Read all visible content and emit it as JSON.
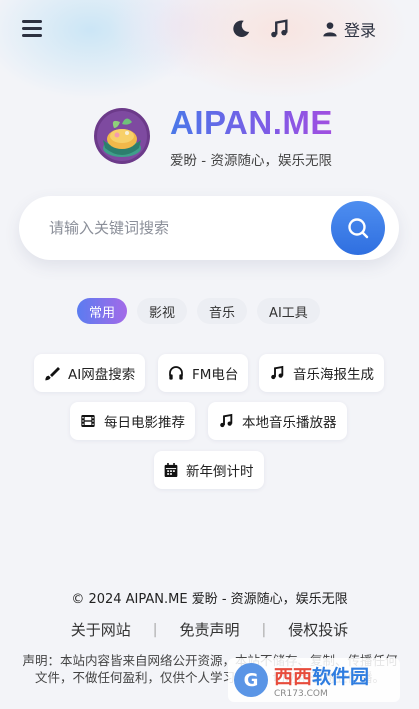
{
  "header": {
    "login_label": "登录"
  },
  "brand": {
    "title": "AIPAN.ME",
    "subtitle": "爱盼 - 资源随心，娱乐无限"
  },
  "search": {
    "placeholder": "请输入关键词搜索",
    "value": ""
  },
  "tabs": [
    {
      "label": "常用",
      "active": true
    },
    {
      "label": "影视",
      "active": false
    },
    {
      "label": "音乐",
      "active": false
    },
    {
      "label": "AI工具",
      "active": false
    }
  ],
  "tools": [
    {
      "label": "AI网盘搜索",
      "icon": "brush-icon"
    },
    {
      "label": "FM电台",
      "icon": "headphones-icon"
    },
    {
      "label": "音乐海报生成",
      "icon": "music-icon"
    },
    {
      "label": "每日电影推荐",
      "icon": "film-icon"
    },
    {
      "label": "本地音乐播放器",
      "icon": "music-icon"
    },
    {
      "label": "新年倒计时",
      "icon": "calendar-icon"
    }
  ],
  "footer": {
    "copyright": "© 2024 AIPAN.ME 爱盼 - 资源随心，娱乐无限",
    "links": [
      "关于网站",
      "免责声明",
      "侵权投诉"
    ],
    "separator": "|",
    "disclaimer": "声明：本站内容皆来自网络公开资源，本站不储存、复制、传播任何文件，不做任何盈利，仅供个人学习交流，切勿用于商业传播。"
  },
  "watermark": {
    "logo_char": "G",
    "text_red": "西西",
    "text_blue": "软件园",
    "text_small": "CR173.COM"
  },
  "colors": {
    "accent_blue": "#2f6fe0",
    "accent_purple": "#a14ee0",
    "background": "#f3f4f8"
  }
}
